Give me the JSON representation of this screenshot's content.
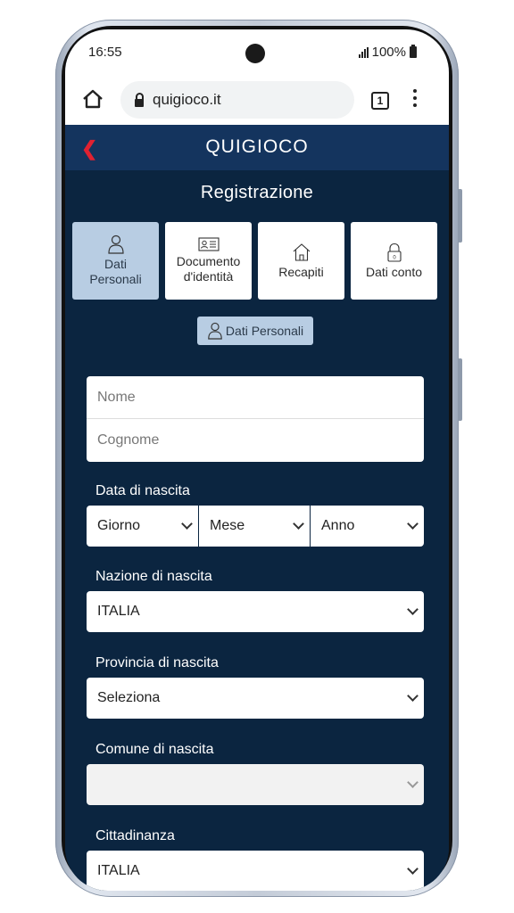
{
  "status": {
    "time": "16:55",
    "battery": "100%"
  },
  "browser": {
    "url": "quigioco.it",
    "tab_count": "1"
  },
  "app": {
    "logo_text": "QUIGIOCO",
    "page_title": "Registrazione"
  },
  "steps": [
    {
      "label1": "Dati",
      "label2": "Personali",
      "icon": "person-icon",
      "active": true
    },
    {
      "label1": "Documento",
      "label2": "d'identità",
      "icon": "id-card-icon",
      "active": false
    },
    {
      "label1": "Recapiti",
      "label2": "",
      "icon": "house-icon",
      "active": false
    },
    {
      "label1": "Dati conto",
      "label2": "",
      "icon": "padlock-icon",
      "active": false
    }
  ],
  "current_step": "Dati Personali",
  "form": {
    "nome_placeholder": "Nome",
    "cognome_placeholder": "Cognome",
    "birth_date_label": "Data di nascita",
    "day_value": "Giorno",
    "month_value": "Mese",
    "year_value": "Anno",
    "birth_country_label": "Nazione di nascita",
    "birth_country_value": "ITALIA",
    "birth_province_label": "Provincia di nascita",
    "birth_province_value": "Seleziona",
    "birth_city_label": "Comune di nascita",
    "birth_city_value": "",
    "citizenship_label": "Cittadinanza",
    "citizenship_value": "ITALIA"
  },
  "colors": {
    "navy": "#0b2540",
    "appbar": "#14345e",
    "accent_red": "#e02131",
    "active_step": "#b8cde3"
  }
}
